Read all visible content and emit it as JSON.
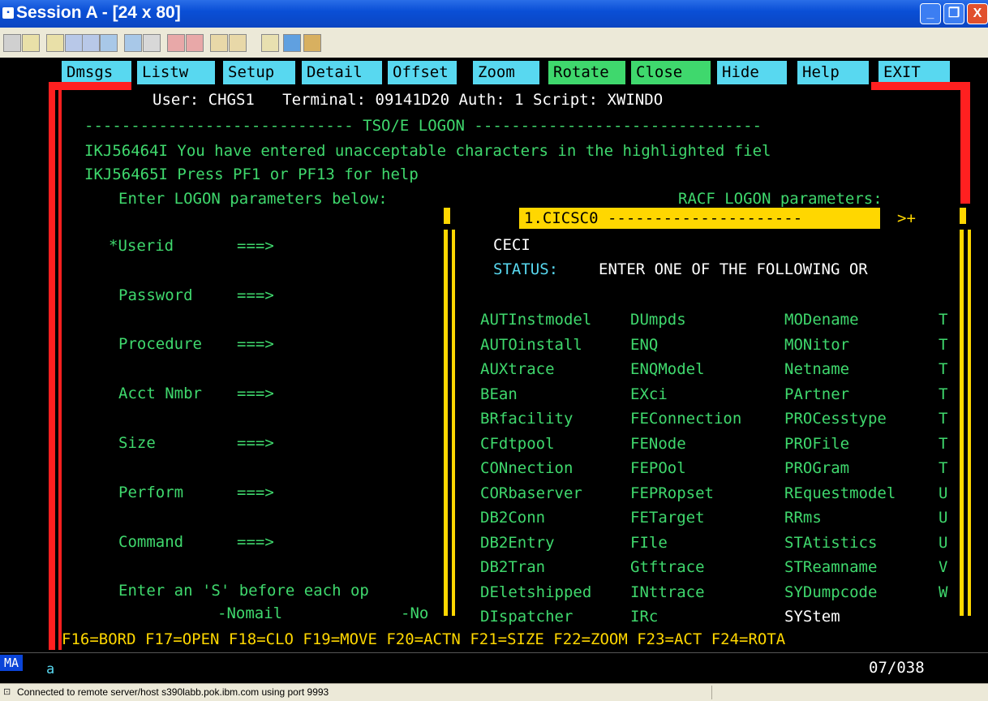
{
  "window": {
    "title": "Session A - [24 x 80]",
    "min_label": "_",
    "max_label": "❐",
    "close_label": "X"
  },
  "toolbar": {
    "buttons": [
      "copy-icon",
      "paste-icon",
      "print-icon",
      "transfer-icon",
      "send-icon",
      "receive-icon",
      "display-icon",
      "macro-icon",
      "record-icon",
      "play-icon",
      "stop-icon",
      "pause-icon",
      "clipboard-icon",
      "globe-icon",
      "tools-icon"
    ]
  },
  "pf_buttons": [
    "Dmsgs",
    "Listw",
    "Setup",
    "Detail",
    "Offset",
    "Zoom",
    "Rotate",
    "Close",
    "Hide",
    "Help",
    "EXIT"
  ],
  "header": {
    "user_line": "User: CHGS1   Terminal: 09141D20 Auth: 1 Script: XWINDO"
  },
  "tso": {
    "banner": "----------------------------- TSO/E LOGON -------------------------------",
    "msg1": "IKJ56464I You have entered unacceptable characters in the highlighted fiel",
    "msg2": "IKJ56465I Press PF1 or PF13 for help",
    "enter_params": "Enter LOGON parameters below:",
    "racf": "RACF LOGON parameters:",
    "fields": [
      {
        "label": "*Userid",
        "arrow": "===>"
      },
      {
        "label": "Password",
        "arrow": "===>"
      },
      {
        "label": "Procedure",
        "arrow": "===>"
      },
      {
        "label": "Acct Nmbr",
        "arrow": "===>"
      },
      {
        "label": "Size",
        "arrow": "===>"
      },
      {
        "label": "Perform",
        "arrow": "===>"
      },
      {
        "label": "Command",
        "arrow": "===>"
      }
    ],
    "enter_s": "Enter an 'S' before each op",
    "nomail": "-Nomail",
    "no": "-No"
  },
  "cics": {
    "window_title": "1.CICSC0 ---------------------",
    "more": ">+",
    "cursor_line": "____",
    "command": "CECI",
    "status_label": "STATUS:",
    "status_text": "ENTER ONE OF THE FOLLOWING OR",
    "rows": [
      [
        "AUTInstmodel",
        "DUmpds",
        "MODename",
        "T"
      ],
      [
        "AUTOinstall",
        "ENQ",
        "MONitor",
        "T"
      ],
      [
        "AUXtrace",
        "ENQModel",
        "Netname",
        "T"
      ],
      [
        "BEan",
        "EXci",
        "PArtner",
        "T"
      ],
      [
        "BRfacility",
        "FEConnection",
        "PROCesstype",
        "T"
      ],
      [
        "CFdtpool",
        "FENode",
        "PROFile",
        "T"
      ],
      [
        "CONnection",
        "FEPOol",
        "PROGram",
        "T"
      ],
      [
        "CORbaserver",
        "FEPRopset",
        "REquestmodel",
        "U"
      ],
      [
        "DB2Conn",
        "FETarget",
        "RRms",
        "U"
      ],
      [
        "DB2Entry",
        "FIle",
        "STAtistics",
        "U"
      ],
      [
        "DB2Tran",
        "Gtftrace",
        "STReamname",
        "V"
      ],
      [
        "DEletshipped",
        "INttrace",
        "SYDumpcode",
        "W"
      ],
      [
        "DIspatcher",
        "IRc",
        "SYStem",
        ""
      ]
    ]
  },
  "fkeys_line": "F16=BORD F17=OPEN F18=CLO F19=MOVE F20=ACTN F21=SIZE F22=ZOOM F23=ACT F24=ROTA",
  "oia": {
    "indicator": "MA",
    "session": "a",
    "cursor_pos": "07/038"
  },
  "status_bar": {
    "text": "Connected to remote server/host s390labb.pok.ibm.com using port 9993"
  },
  "colors": {
    "green": "#3fd86d",
    "cyan": "#58d8f0",
    "yellow": "#ffd700",
    "red": "#ff2020",
    "titlebar": "#0a4fd6"
  }
}
